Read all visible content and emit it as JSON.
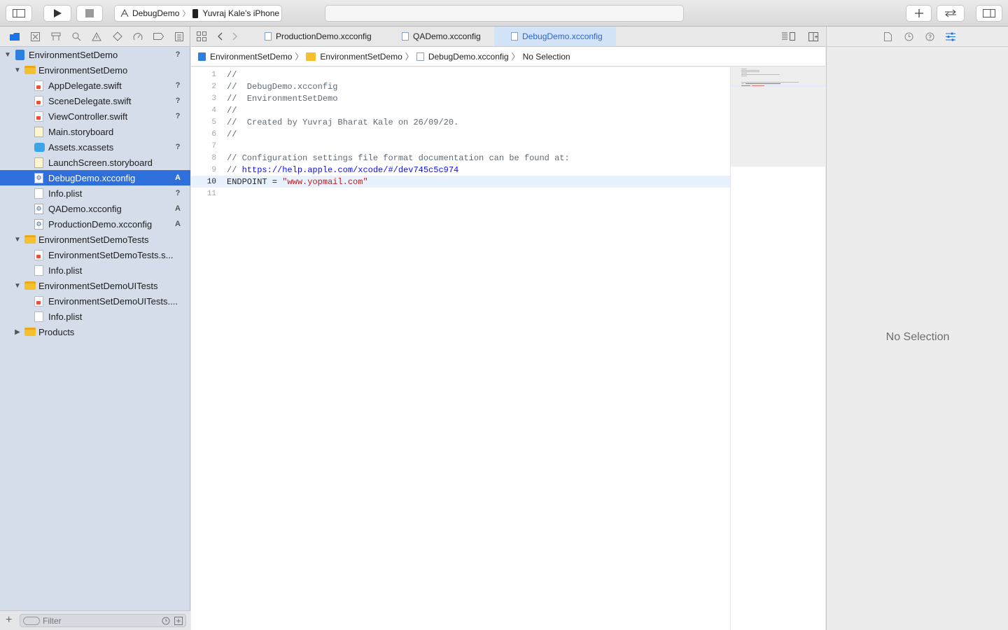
{
  "toolbar": {
    "scheme": "DebugDemo",
    "device": "Yuvraj  Kale's iPhone",
    "activity": ""
  },
  "navigator": {
    "filter_placeholder": "Filter",
    "items": [
      {
        "label": "EnvironmentSetDemo",
        "kind": "project",
        "depth": 0,
        "disclosure": "open",
        "status": "?"
      },
      {
        "label": "EnvironmentSetDemo",
        "kind": "folder",
        "depth": 1,
        "disclosure": "open",
        "status": ""
      },
      {
        "label": "AppDelegate.swift",
        "kind": "swift",
        "depth": 2,
        "status": "?"
      },
      {
        "label": "SceneDelegate.swift",
        "kind": "swift",
        "depth": 2,
        "status": "?"
      },
      {
        "label": "ViewController.swift",
        "kind": "swift",
        "depth": 2,
        "status": "?"
      },
      {
        "label": "Main.storyboard",
        "kind": "storyboard",
        "depth": 2,
        "status": ""
      },
      {
        "label": "Assets.xcassets",
        "kind": "assets",
        "depth": 2,
        "status": "?"
      },
      {
        "label": "LaunchScreen.storyboard",
        "kind": "storyboard",
        "depth": 2,
        "status": ""
      },
      {
        "label": "DebugDemo.xcconfig",
        "kind": "xcconfig",
        "depth": 2,
        "status": "A",
        "selected": true
      },
      {
        "label": "Info.plist",
        "kind": "plist",
        "depth": 2,
        "status": "?"
      },
      {
        "label": "QADemo.xcconfig",
        "kind": "xcconfig",
        "depth": 2,
        "status": "A"
      },
      {
        "label": "ProductionDemo.xcconfig",
        "kind": "xcconfig",
        "depth": 2,
        "status": "A"
      },
      {
        "label": "EnvironmentSetDemoTests",
        "kind": "folder",
        "depth": 1,
        "disclosure": "open",
        "status": ""
      },
      {
        "label": "EnvironmentSetDemoTests.s...",
        "kind": "swift",
        "depth": 2,
        "status": ""
      },
      {
        "label": "Info.plist",
        "kind": "plist",
        "depth": 2,
        "status": ""
      },
      {
        "label": "EnvironmentSetDemoUITests",
        "kind": "folder",
        "depth": 1,
        "disclosure": "open",
        "status": ""
      },
      {
        "label": "EnvironmentSetDemoUITests....",
        "kind": "swift",
        "depth": 2,
        "status": ""
      },
      {
        "label": "Info.plist",
        "kind": "plist",
        "depth": 2,
        "status": ""
      },
      {
        "label": "Products",
        "kind": "folder",
        "depth": 1,
        "disclosure": "closed",
        "status": ""
      }
    ]
  },
  "tabs": [
    {
      "label": "ProductionDemo.xcconfig",
      "active": false
    },
    {
      "label": "QADemo.xcconfig",
      "active": false
    },
    {
      "label": "DebugDemo.xcconfig",
      "active": true
    }
  ],
  "jumpbar": {
    "crumbs": [
      "EnvironmentSetDemo",
      "EnvironmentSetDemo",
      "DebugDemo.xcconfig",
      "No Selection"
    ]
  },
  "editor": {
    "current_line": 10,
    "lines": [
      {
        "n": "1",
        "text": "//",
        "kind": "comment"
      },
      {
        "n": "2",
        "text": "//  DebugDemo.xcconfig",
        "kind": "comment"
      },
      {
        "n": "3",
        "text": "//  EnvironmentSetDemo",
        "kind": "comment"
      },
      {
        "n": "4",
        "text": "//",
        "kind": "comment"
      },
      {
        "n": "5",
        "text": "//  Created by Yuvraj Bharat Kale on 26/09/20.",
        "kind": "comment"
      },
      {
        "n": "6",
        "text": "//",
        "kind": "comment"
      },
      {
        "n": "7",
        "text": "",
        "kind": "plain"
      },
      {
        "n": "8",
        "text": "// Configuration settings file format documentation can be found at:",
        "kind": "comment"
      },
      {
        "n": "9",
        "text": "// ",
        "url": "https://help.apple.com/xcode/#/dev745c5c974",
        "kind": "url"
      },
      {
        "n": "10",
        "text": "ENDPOINT = ",
        "str": "\"www.yopmail.com\"",
        "kind": "assign"
      },
      {
        "n": "11",
        "text": "",
        "kind": "plain"
      }
    ]
  },
  "inspector": {
    "empty_message": "No Selection"
  },
  "colors": {
    "accent": "#2f6fdb",
    "comment": "#5d6c79",
    "url": "#0e0eff",
    "string": "#c41a16"
  }
}
